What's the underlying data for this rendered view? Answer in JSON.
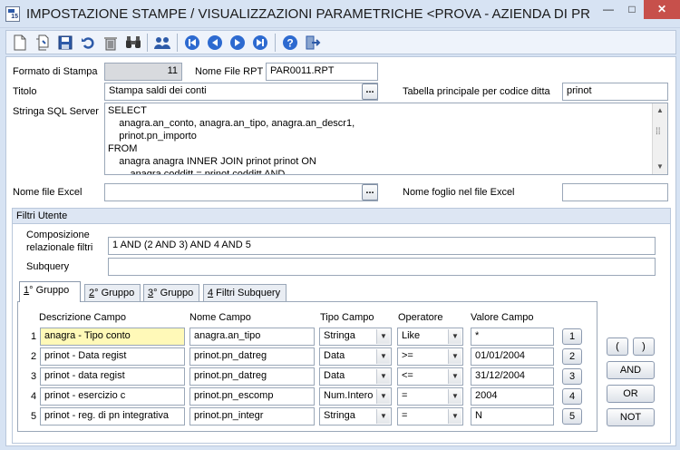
{
  "window": {
    "title": "IMPOSTAZIONE STAMPE / VISUALIZZAZIONI PARAMETRICHE <PROVA - AZIENDA DI PROV...",
    "app_icon_text": "15",
    "minimize": "—",
    "maximize": "□",
    "close": "✕"
  },
  "toolbar": {
    "icons": [
      "new-document-icon",
      "copy-document-icon",
      "save-icon",
      "undo-icon",
      "delete-icon",
      "find-icon",
      "users-icon",
      "first-record-icon",
      "previous-record-icon",
      "next-record-icon",
      "last-record-icon",
      "help-icon",
      "exit-icon"
    ]
  },
  "form": {
    "formato_label": "Formato di Stampa",
    "formato_value": "11",
    "nome_file_rpt_label": "Nome File RPT",
    "nome_file_rpt_value": "PAR0011.RPT",
    "titolo_label": "Titolo",
    "titolo_value": "Stampa saldi dei conti",
    "tabella_label": "Tabella principale per codice ditta",
    "tabella_value": "prinot",
    "sql_label": "Stringa SQL Server",
    "sql_value": "SELECT\n    anagra.an_conto, anagra.an_tipo, anagra.an_descr1,\n    prinot.pn_importo\nFROM\n    anagra anagra INNER JOIN prinot prinot ON\n        anagra.codditt = prinot.codditt AND",
    "excel_file_label": "Nome file Excel",
    "excel_file_value": "",
    "excel_sheet_label": "Nome foglio nel file Excel",
    "excel_sheet_value": "",
    "ellipsis": "..."
  },
  "filters": {
    "group_title": "Filtri Utente",
    "composizione_label_1": "Composizione",
    "composizione_label_2": "relazionale filtri",
    "composizione_value": "1 AND (2 AND 3) AND 4 AND 5",
    "subquery_label": "Subquery",
    "subquery_value": "",
    "tabs": [
      {
        "key": "1",
        "rest": "° Gruppo"
      },
      {
        "key": "2",
        "rest": "° Gruppo"
      },
      {
        "key": "3",
        "rest": "° Gruppo"
      },
      {
        "key": "4",
        "rest": " Filtri Subquery"
      }
    ],
    "columns": {
      "descrizione": "Descrizione Campo",
      "nome": "Nome Campo",
      "tipo": "Tipo Campo",
      "operatore": "Operatore",
      "valore": "Valore Campo"
    },
    "rows": [
      {
        "num": "1",
        "descrizione": "anagra - Tipo conto",
        "nome": "anagra.an_tipo",
        "tipo": "Stringa",
        "operatore": "Like",
        "valore": "*",
        "btn": "1"
      },
      {
        "num": "2",
        "descrizione": "prinot - Data regist",
        "nome": "prinot.pn_datreg",
        "tipo": "Data",
        "operatore": ">=",
        "valore": "01/01/2004",
        "btn": "2"
      },
      {
        "num": "3",
        "descrizione": "prinot - data regist",
        "nome": "prinot.pn_datreg",
        "tipo": "Data",
        "operatore": "<=",
        "valore": "31/12/2004",
        "btn": "3"
      },
      {
        "num": "4",
        "descrizione": "prinot - esercizio c",
        "nome": "prinot.pn_escomp",
        "tipo": "Num.Intero",
        "operatore": "=",
        "valore": "2004",
        "btn": "4"
      },
      {
        "num": "5",
        "descrizione": "prinot - reg. di pn integrativa",
        "nome": "prinot.pn_integr",
        "tipo": "Stringa",
        "operatore": "=",
        "valore": "N",
        "btn": "5"
      }
    ],
    "buttons": {
      "open_paren": "(",
      "close_paren": ")",
      "and": "AND",
      "or": "OR",
      "not": "NOT"
    }
  }
}
